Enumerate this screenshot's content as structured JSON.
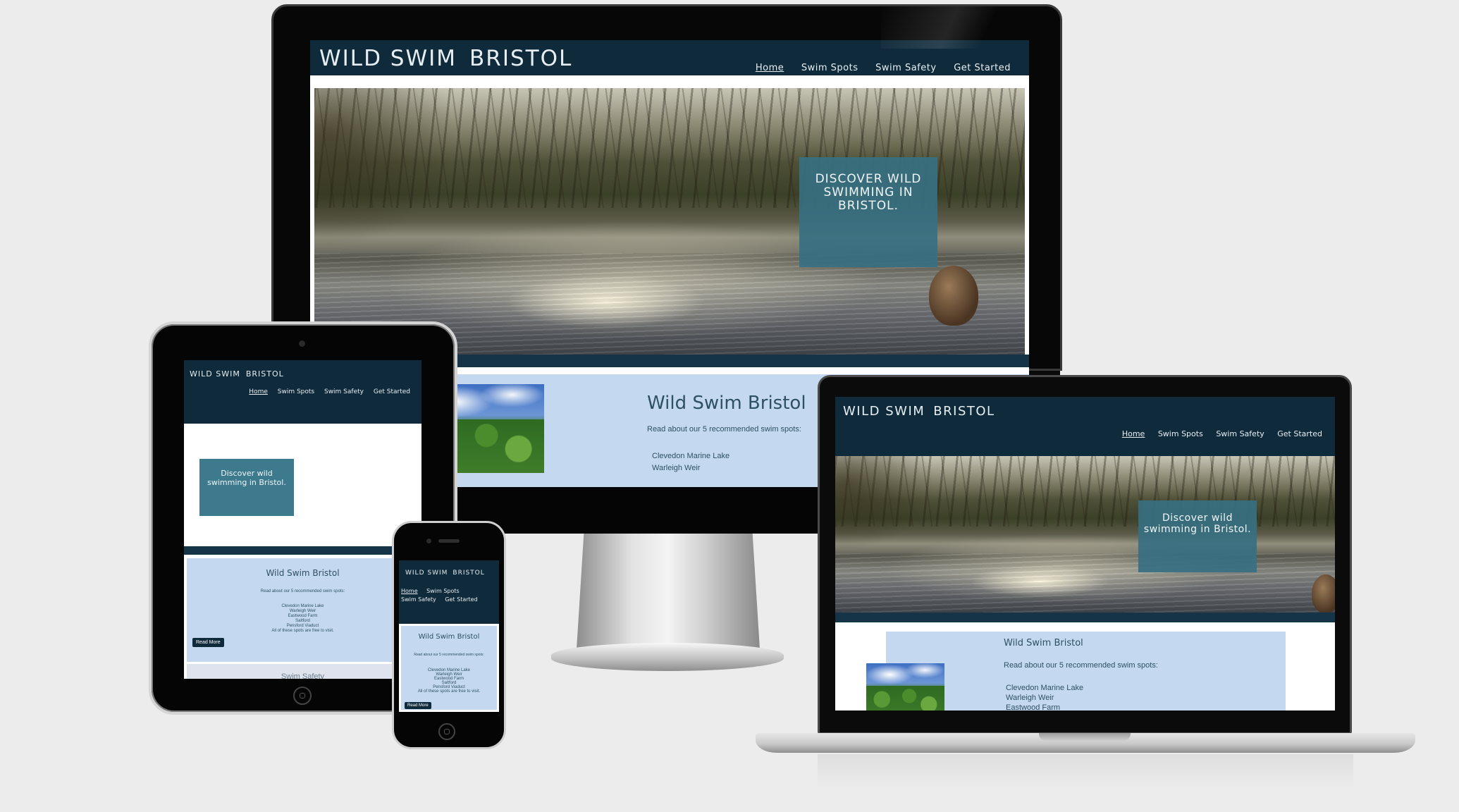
{
  "site": {
    "logo_part1": "WILD SWIM",
    "logo_part2": "BRISTOL",
    "nav": [
      "Home",
      "Swim Spots",
      "Swim Safety",
      "Get Started"
    ],
    "hero_cta_desktop": "DISCOVER WILD SWIMMING IN BRISTOL.",
    "hero_cta": "Discover wild swimming in Bristol.",
    "about_title": "Wild Swim Bristol",
    "about_intro": "Read about our 5 recommended swim spots:",
    "spots": [
      "Clevedon Marine Lake",
      "Warleigh Weir",
      "Eastwood Farm",
      "Saltford",
      "Pensford Viaduct"
    ],
    "spots_note": "All of these spots are free to visit.",
    "read_more": "Read More",
    "safety_title": "Swim Safety"
  },
  "colors": {
    "header_bg": "#0f2a3a",
    "cta_bg": "#377082",
    "about_bg": "#c4d9f0",
    "page_bg": "#ececec"
  }
}
